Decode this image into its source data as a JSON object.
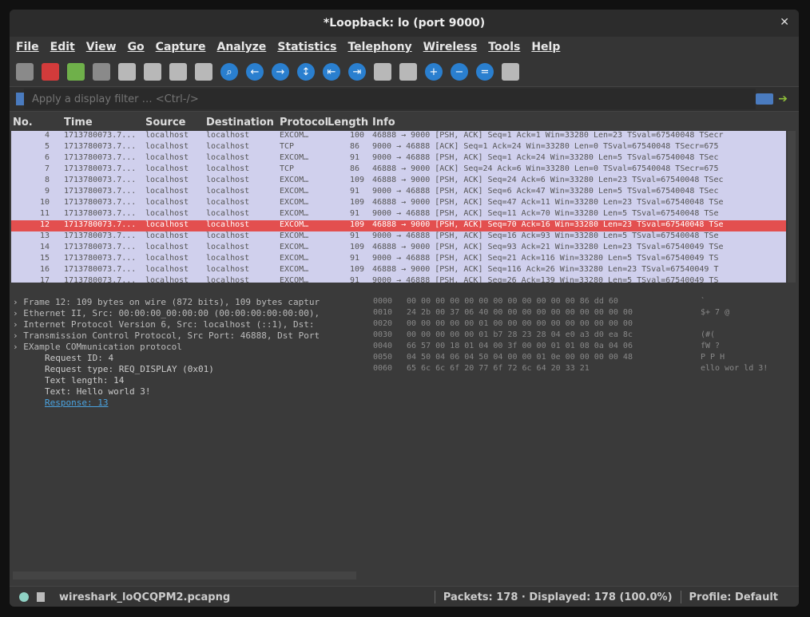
{
  "window": {
    "title": "*Loopback: lo (port 9000)"
  },
  "menu": [
    "File",
    "Edit",
    "View",
    "Go",
    "Capture",
    "Analyze",
    "Statistics",
    "Telephony",
    "Wireless",
    "Tools",
    "Help"
  ],
  "filter": {
    "placeholder": "Apply a display filter … <Ctrl-/>"
  },
  "columns": [
    "No.",
    "Time",
    "Source",
    "Destination",
    "Protocol",
    "Length",
    "Info"
  ],
  "packets": [
    {
      "no": "4",
      "time": "1713780073.7...",
      "src": "localhost",
      "dst": "localhost",
      "proto": "EXCOM…",
      "len": "100",
      "info": "46888 → 9000 [PSH, ACK] Seq=1 Ack=1 Win=33280 Len=23 TSval=67540048 TSecr"
    },
    {
      "no": "5",
      "time": "1713780073.7...",
      "src": "localhost",
      "dst": "localhost",
      "proto": "TCP",
      "len": "86",
      "info": "9000 → 46888 [ACK] Seq=1 Ack=24 Win=33280 Len=0 TSval=67540048 TSecr=675"
    },
    {
      "no": "6",
      "time": "1713780073.7...",
      "src": "localhost",
      "dst": "localhost",
      "proto": "EXCOM…",
      "len": "91",
      "info": "9000 → 46888 [PSH, ACK] Seq=1 Ack=24 Win=33280 Len=5 TSval=67540048 TSec"
    },
    {
      "no": "7",
      "time": "1713780073.7...",
      "src": "localhost",
      "dst": "localhost",
      "proto": "TCP",
      "len": "86",
      "info": "46888 → 9000 [ACK] Seq=24 Ack=6 Win=33280 Len=0 TSval=67540048 TSecr=675"
    },
    {
      "no": "8",
      "time": "1713780073.7...",
      "src": "localhost",
      "dst": "localhost",
      "proto": "EXCOM…",
      "len": "109",
      "info": "46888 → 9000 [PSH, ACK] Seq=24 Ack=6 Win=33280 Len=23 TSval=67540048 TSec"
    },
    {
      "no": "9",
      "time": "1713780073.7...",
      "src": "localhost",
      "dst": "localhost",
      "proto": "EXCOM…",
      "len": "91",
      "info": "9000 → 46888 [PSH, ACK] Seq=6 Ack=47 Win=33280 Len=5 TSval=67540048 TSec"
    },
    {
      "no": "10",
      "time": "1713780073.7...",
      "src": "localhost",
      "dst": "localhost",
      "proto": "EXCOM…",
      "len": "109",
      "info": "46888 → 9000 [PSH, ACK] Seq=47 Ack=11 Win=33280 Len=23 TSval=67540048 TSe"
    },
    {
      "no": "11",
      "time": "1713780073.7...",
      "src": "localhost",
      "dst": "localhost",
      "proto": "EXCOM…",
      "len": "91",
      "info": "9000 → 46888 [PSH, ACK] Seq=11 Ack=70 Win=33280 Len=5 TSval=67540048 TSe"
    },
    {
      "no": "12",
      "time": "1713780073.7...",
      "src": "localhost",
      "dst": "localhost",
      "proto": "EXCOM…",
      "len": "109",
      "info": "46888 → 9000 [PSH, ACK] Seq=70 Ack=16 Win=33280 Len=23 TSval=67540048 TSe",
      "selected": true
    },
    {
      "no": "13",
      "time": "1713780073.7...",
      "src": "localhost",
      "dst": "localhost",
      "proto": "EXCOM…",
      "len": "91",
      "info": "9000 → 46888 [PSH, ACK] Seq=16 Ack=93 Win=33280 Len=5 TSval=67540048 TSe"
    },
    {
      "no": "14",
      "time": "1713780073.7...",
      "src": "localhost",
      "dst": "localhost",
      "proto": "EXCOM…",
      "len": "109",
      "info": "46888 → 9000 [PSH, ACK] Seq=93 Ack=21 Win=33280 Len=23 TSval=67540049 TSe"
    },
    {
      "no": "15",
      "time": "1713780073.7...",
      "src": "localhost",
      "dst": "localhost",
      "proto": "EXCOM…",
      "len": "91",
      "info": "9000 → 46888 [PSH, ACK] Seq=21 Ack=116 Win=33280 Len=5 TSval=67540049 TS"
    },
    {
      "no": "16",
      "time": "1713780073.7...",
      "src": "localhost",
      "dst": "localhost",
      "proto": "EXCOM…",
      "len": "109",
      "info": "46888 → 9000 [PSH, ACK] Seq=116 Ack=26 Win=33280 Len=23 TSval=67540049 T"
    },
    {
      "no": "17",
      "time": "1713780073.7...",
      "src": "localhost",
      "dst": "localhost",
      "proto": "EXCOM…",
      "len": "91",
      "info": "9000 → 46888 [PSH, ACK] Seq=26 Ack=139 Win=33280 Len=5 TSval=67540049 TS"
    }
  ],
  "details": [
    {
      "text": "Frame 12: 109 bytes on wire (872 bits), 109 bytes captur",
      "type": "top"
    },
    {
      "text": "Ethernet II, Src: 00:00:00_00:00:00 (00:00:00:00:00:00),",
      "type": "top"
    },
    {
      "text": "Internet Protocol Version 6, Src: localhost (::1), Dst:",
      "type": "top"
    },
    {
      "text": "Transmission Control Protocol, Src Port: 46888, Dst Port",
      "type": "top"
    },
    {
      "text": "EXample COMmunication protocol",
      "type": "top"
    },
    {
      "text": "Request ID: 4",
      "type": "child"
    },
    {
      "text": "Request type: REQ_DISPLAY (0x01)",
      "type": "child"
    },
    {
      "text": "Text length: 14",
      "type": "child"
    },
    {
      "text": "Text: Hello world 3!",
      "type": "child"
    },
    {
      "text": "Response: 13",
      "type": "link"
    }
  ],
  "hex": [
    {
      "off": "0000",
      "bytes": "00 00 00 00 00 00 00 00  00 00 00 00 86 dd 60",
      "ascii": "       `"
    },
    {
      "off": "0010",
      "bytes": "24 2b 00 37 06 40 00 00  00 00 00 00 00 00 00 00",
      "ascii": "$+ 7 @"
    },
    {
      "off": "0020",
      "bytes": "00 00 00 00 00 01 00 00  00 00 00 00 00 00 00 00",
      "ascii": ""
    },
    {
      "off": "0030",
      "bytes": "00 00 00 00 00 01 b7 28  23 28 04 e0 a3 d0 ea 8c",
      "ascii": "  (#("
    },
    {
      "off": "0040",
      "bytes": "66 57 00 18 01 04 00 3f  00 00 01 01 08 0a 04 06",
      "ascii": "fW  ?"
    },
    {
      "off": "0050",
      "bytes": "04 50 04 06 04 50 04 00  00 01 0e 00 00 00 00 48",
      "ascii": " P  P    H"
    },
    {
      "off": "0060",
      "bytes": "65 6c 6c 6f 20 77 6f 72  6c 64 20 33 21",
      "ascii": "ello wor ld 3!"
    }
  ],
  "status": {
    "file": "wireshark_loQCQPM2.pcapng",
    "packets": "Packets: 178 · Displayed: 178 (100.0%)",
    "profile": "Profile: Default"
  }
}
